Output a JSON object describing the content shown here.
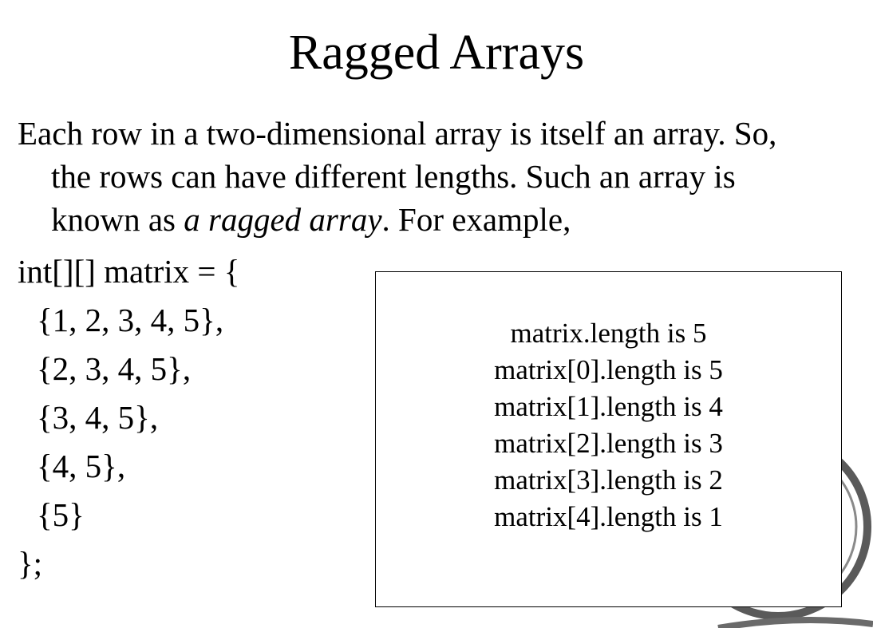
{
  "slide": {
    "title": "Ragged Arrays",
    "paragraph": {
      "line1": "Each row in a two-dimensional array is itself an array. So,",
      "line2": "the rows can have different lengths. Such an array is",
      "line3_before": "known as ",
      "line3_emphasis": "a ragged array",
      "line3_after": ". For example,"
    },
    "code": [
      "int[][] matrix = {",
      "{1, 2, 3, 4, 5},",
      "{2, 3, 4, 5},",
      "{3, 4, 5},",
      "{4, 5},",
      "{5}",
      "};"
    ],
    "info_box": [
      "matrix.length is 5",
      "matrix[0].length is 5",
      "matrix[1].length is 4",
      "matrix[2].length is 3",
      "matrix[3].length is 2",
      "matrix[4].length is 1"
    ]
  },
  "colors": {
    "background": "#ffffff",
    "text": "#000000",
    "decoration": "#5a5a5a"
  }
}
